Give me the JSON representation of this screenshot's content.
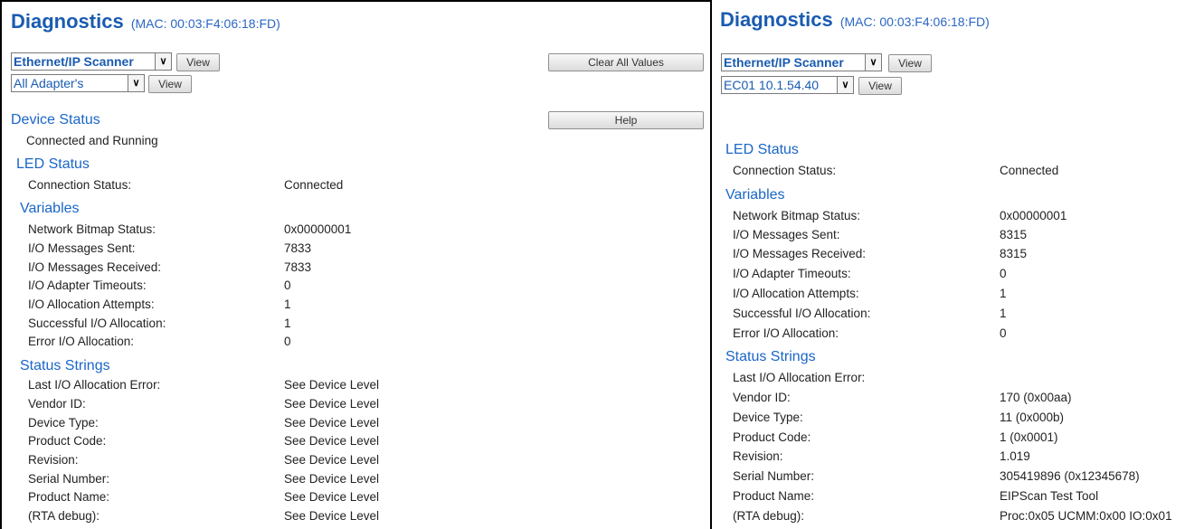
{
  "left": {
    "title": "Diagnostics",
    "mac": "(MAC: 00:03:F4:06:18:FD)",
    "scanner_select": "Ethernet/IP Scanner",
    "view_label": "View",
    "adapter_select": "All Adapter's",
    "adapter_view_label": "View",
    "clear_all_label": "Clear All Values",
    "help_label": "Help",
    "device_status_heading": "Device Status",
    "device_status_text": "Connected and Running",
    "led_heading": "LED Status",
    "led_rows": [
      {
        "label": "Connection Status:",
        "value": "Connected"
      }
    ],
    "variables_heading": "Variables",
    "variables_rows": [
      {
        "label": "Network Bitmap Status:",
        "value": "0x00000001"
      },
      {
        "label": "I/O Messages Sent:",
        "value": "7833"
      },
      {
        "label": "I/O Messages Received:",
        "value": "7833"
      },
      {
        "label": "I/O Adapter Timeouts:",
        "value": "0"
      },
      {
        "label": "I/O Allocation Attempts:",
        "value": "1"
      },
      {
        "label": "Successful I/O Allocation:",
        "value": "1"
      },
      {
        "label": "Error I/O Allocation:",
        "value": "0"
      }
    ],
    "status_heading": "Status Strings",
    "status_rows": [
      {
        "label": "Last I/O Allocation Error:",
        "value": "See Device Level"
      },
      {
        "label": "Vendor ID:",
        "value": "See Device Level"
      },
      {
        "label": "Device Type:",
        "value": "See Device Level"
      },
      {
        "label": "Product Code:",
        "value": "See Device Level"
      },
      {
        "label": "Revision:",
        "value": "See Device Level"
      },
      {
        "label": "Serial Number:",
        "value": "See Device Level"
      },
      {
        "label": "Product Name:",
        "value": "See Device Level"
      },
      {
        "label": "(RTA debug):",
        "value": "See Device Level"
      }
    ]
  },
  "right": {
    "title": "Diagnostics",
    "mac": "(MAC: 00:03:F4:06:18:FD)",
    "scanner_select": "Ethernet/IP Scanner",
    "view_label": "View",
    "adapter_select": "EC01 10.1.54.40",
    "adapter_view_label": "View",
    "led_heading": "LED Status",
    "led_rows": [
      {
        "label": "Connection Status:",
        "value": "Connected"
      }
    ],
    "variables_heading": "Variables",
    "variables_rows": [
      {
        "label": "Network Bitmap Status:",
        "value": "0x00000001"
      },
      {
        "label": "I/O Messages Sent:",
        "value": "8315"
      },
      {
        "label": "I/O Messages Received:",
        "value": "8315"
      },
      {
        "label": "I/O Adapter Timeouts:",
        "value": "0"
      },
      {
        "label": "I/O Allocation Attempts:",
        "value": "1"
      },
      {
        "label": "Successful I/O Allocation:",
        "value": "1"
      },
      {
        "label": "Error I/O Allocation:",
        "value": "0"
      }
    ],
    "status_heading": "Status Strings",
    "status_rows": [
      {
        "label": "Last I/O Allocation Error:",
        "value": ""
      },
      {
        "label": "Vendor ID:",
        "value": "170 (0x00aa)"
      },
      {
        "label": "Device Type:",
        "value": "11 (0x000b)"
      },
      {
        "label": "Product Code:",
        "value": "1 (0x0001)"
      },
      {
        "label": "Revision:",
        "value": "1.019"
      },
      {
        "label": "Serial Number:",
        "value": "305419896 (0x12345678)"
      },
      {
        "label": "Product Name:",
        "value": "EIPScan Test Tool"
      },
      {
        "label": "(RTA debug):",
        "value": "Proc:0x05 UCMM:0x00 IO:0x01"
      }
    ]
  }
}
